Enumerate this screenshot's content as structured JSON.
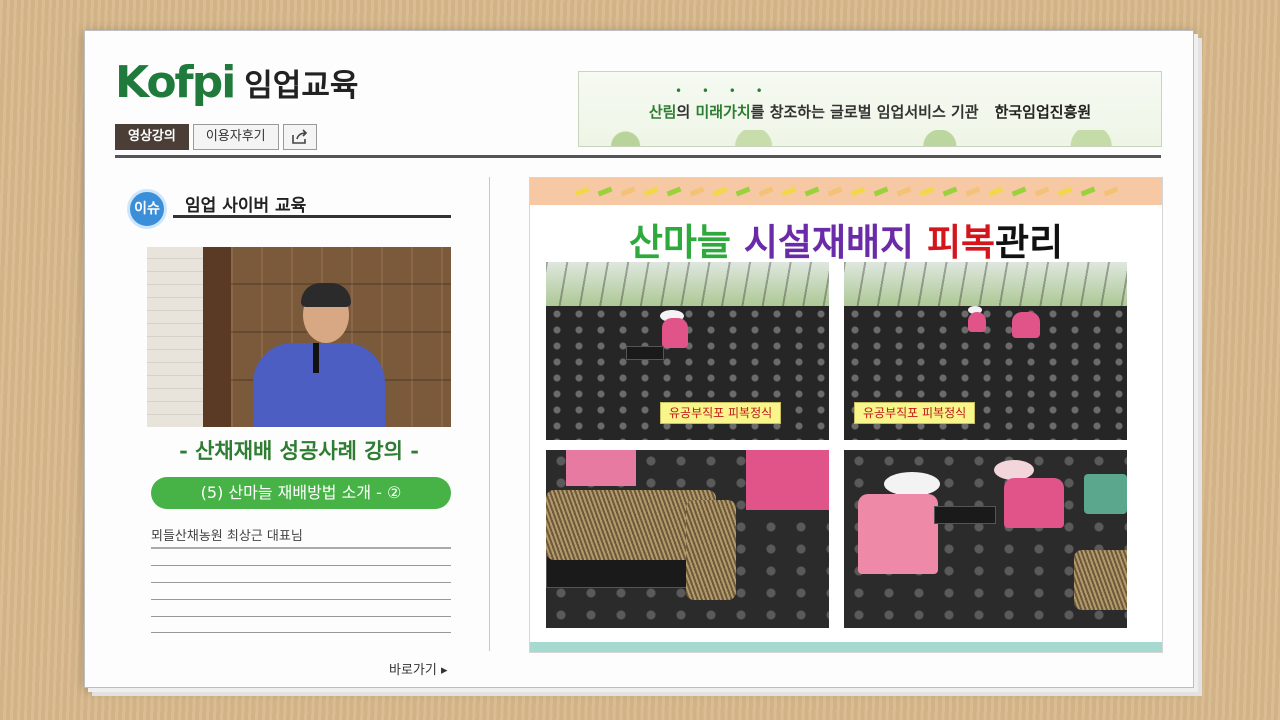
{
  "logo": {
    "mark": "Kofpi",
    "text": "임업교육"
  },
  "banner": {
    "slogan_a": "산림",
    "slogan_b": "의 ",
    "slogan_c": "미래가치",
    "slogan_d": "를 창조하는 글로벌 임업서비스 기관",
    "org": "한국임업진흥원"
  },
  "tabs": [
    {
      "label": "영상강의"
    },
    {
      "label": "이용자후기"
    }
  ],
  "share_icon": "share-icon",
  "issue": {
    "badge": "이슈",
    "title": "임업 사이버 교육"
  },
  "lecture": {
    "title": "- 산채재배 성공사례 강의 -",
    "episode": "(5) 산마늘 재배방법 소개 - ②",
    "presenter": "뫼들산채농원 최상근 대표님"
  },
  "goto": {
    "label": "바로가기 ▸"
  },
  "slide": {
    "title_parts": [
      {
        "text": "산마늘 ",
        "color": "#2eaa3c"
      },
      {
        "text": "시설재배지 ",
        "color": "#6b2aa8"
      },
      {
        "text": "피복",
        "color": "#d4161c"
      },
      {
        "text": "관리",
        "color": "#111111"
      }
    ],
    "captions": [
      "유공부직포 피복정식",
      "유공부직포 피복정식"
    ],
    "tick_colors": [
      "#f0d84a",
      "#9bd13c",
      "#f3c276",
      "#f0d84a",
      "#9bd13c",
      "#f3c276"
    ]
  },
  "colors": {
    "accent_green": "#47b347",
    "dark_tab": "#4b3e37",
    "badge_blue": "#3b8fd9"
  }
}
